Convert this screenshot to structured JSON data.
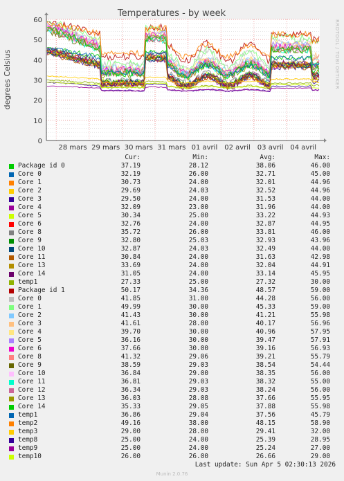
{
  "chart_data": {
    "type": "line",
    "title": "Temperatures - by week",
    "ylabel": "degrees Celsius",
    "ylim": [
      0,
      60
    ],
    "yticks": [
      0,
      10,
      20,
      30,
      40,
      50,
      60
    ],
    "x_categories": [
      "28 mars",
      "29 mars",
      "30 mars",
      "31 mars",
      "01 avril",
      "02 avril",
      "03 avril",
      "04 avril"
    ],
    "side_label": "RRDTOOL / TOBI OETIKER",
    "grid": true,
    "legend_headers": {
      "cur": "Cur:",
      "min": "Min:",
      "avg": "Avg:",
      "max": "Max:"
    },
    "series": [
      {
        "name": "Package id 0",
        "color": "#00cc00",
        "cur": "37.19",
        "min": "28.12",
        "avg": "38.06",
        "max": "46.00"
      },
      {
        "name": "Core 0",
        "color": "#0066b3",
        "cur": "32.19",
        "min": "26.00",
        "avg": "32.71",
        "max": "45.00"
      },
      {
        "name": "Core 1",
        "color": "#ff8000",
        "cur": "30.73",
        "min": "24.00",
        "avg": "32.01",
        "max": "44.96"
      },
      {
        "name": "Core 2",
        "color": "#ffcc00",
        "cur": "29.69",
        "min": "24.03",
        "avg": "32.52",
        "max": "44.96"
      },
      {
        "name": "Core 3",
        "color": "#330099",
        "cur": "29.50",
        "min": "24.00",
        "avg": "31.53",
        "max": "44.00"
      },
      {
        "name": "Core 4",
        "color": "#990099",
        "cur": "32.09",
        "min": "23.00",
        "avg": "31.96",
        "max": "44.00"
      },
      {
        "name": "Core 5",
        "color": "#ccff00",
        "cur": "30.34",
        "min": "25.00",
        "avg": "33.22",
        "max": "44.93"
      },
      {
        "name": "Core 6",
        "color": "#ff0000",
        "cur": "32.76",
        "min": "24.00",
        "avg": "32.87",
        "max": "44.95"
      },
      {
        "name": "Core 8",
        "color": "#808080",
        "cur": "35.72",
        "min": "26.00",
        "avg": "33.81",
        "max": "46.00"
      },
      {
        "name": "Core 9",
        "color": "#008f00",
        "cur": "32.80",
        "min": "25.03",
        "avg": "32.93",
        "max": "43.96"
      },
      {
        "name": "Core 10",
        "color": "#00487d",
        "cur": "32.87",
        "min": "24.03",
        "avg": "32.49",
        "max": "44.00"
      },
      {
        "name": "Core 11",
        "color": "#b35a00",
        "cur": "30.84",
        "min": "24.00",
        "avg": "31.63",
        "max": "42.98"
      },
      {
        "name": "Core 13",
        "color": "#b38f00",
        "cur": "33.69",
        "min": "24.00",
        "avg": "32.04",
        "max": "44.91"
      },
      {
        "name": "Core 14",
        "color": "#6b006b",
        "cur": "31.05",
        "min": "24.00",
        "avg": "33.14",
        "max": "45.95"
      },
      {
        "name": "temp1",
        "color": "#8fb300",
        "cur": "27.33",
        "min": "25.00",
        "avg": "27.32",
        "max": "30.00"
      },
      {
        "name": "Package id 1",
        "color": "#b30000",
        "cur": "50.17",
        "min": "34.36",
        "avg": "48.57",
        "max": "59.00"
      },
      {
        "name": "Core 0",
        "color": "#bebebe",
        "cur": "41.85",
        "min": "31.00",
        "avg": "44.28",
        "max": "56.00"
      },
      {
        "name": "Core 1",
        "color": "#80ff80",
        "cur": "49.99",
        "min": "30.00",
        "avg": "45.33",
        "max": "59.00"
      },
      {
        "name": "Core 2",
        "color": "#80c9ff",
        "cur": "41.43",
        "min": "30.00",
        "avg": "41.21",
        "max": "55.98"
      },
      {
        "name": "Core 3",
        "color": "#ffc080",
        "cur": "41.61",
        "min": "28.00",
        "avg": "40.17",
        "max": "56.96"
      },
      {
        "name": "Core 4",
        "color": "#ffe680",
        "cur": "39.70",
        "min": "30.00",
        "avg": "40.96",
        "max": "57.95"
      },
      {
        "name": "Core 5",
        "color": "#aa80ff",
        "cur": "36.16",
        "min": "30.00",
        "avg": "39.47",
        "max": "57.91"
      },
      {
        "name": "Core 6",
        "color": "#ee00cc",
        "cur": "37.66",
        "min": "30.00",
        "avg": "39.16",
        "max": "56.93"
      },
      {
        "name": "Core 8",
        "color": "#ff8080",
        "cur": "41.32",
        "min": "29.06",
        "avg": "39.21",
        "max": "55.79"
      },
      {
        "name": "Core 9",
        "color": "#666600",
        "cur": "38.59",
        "min": "29.03",
        "avg": "38.54",
        "max": "54.44"
      },
      {
        "name": "Core 10",
        "color": "#ffbfff",
        "cur": "36.84",
        "min": "29.00",
        "avg": "38.35",
        "max": "56.00"
      },
      {
        "name": "Core 11",
        "color": "#00ffcc",
        "cur": "36.81",
        "min": "29.03",
        "avg": "38.32",
        "max": "55.00"
      },
      {
        "name": "Core 12",
        "color": "#cc6699",
        "cur": "36.34",
        "min": "29.03",
        "avg": "38.24",
        "max": "56.00"
      },
      {
        "name": "Core 13",
        "color": "#999900",
        "cur": "36.03",
        "min": "28.08",
        "avg": "37.66",
        "max": "55.95"
      },
      {
        "name": "Core 14",
        "color": "#00cc00",
        "cur": "35.33",
        "min": "29.05",
        "avg": "37.88",
        "max": "55.98"
      },
      {
        "name": "temp1",
        "color": "#0066b3",
        "cur": "36.86",
        "min": "29.04",
        "avg": "37.56",
        "max": "45.79"
      },
      {
        "name": "temp2",
        "color": "#ff8000",
        "cur": "49.16",
        "min": "38.00",
        "avg": "48.15",
        "max": "58.90"
      },
      {
        "name": "temp3",
        "color": "#ffcc00",
        "cur": "29.00",
        "min": "28.00",
        "avg": "29.41",
        "max": "32.00"
      },
      {
        "name": "temp8",
        "color": "#330099",
        "cur": "25.00",
        "min": "24.00",
        "avg": "25.39",
        "max": "28.95"
      },
      {
        "name": "temp9",
        "color": "#990099",
        "cur": "25.00",
        "min": "24.00",
        "avg": "25.24",
        "max": "27.00"
      },
      {
        "name": "temp10",
        "color": "#ccff00",
        "cur": "26.00",
        "min": "26.00",
        "avg": "26.66",
        "max": "29.00"
      }
    ]
  },
  "footer": {
    "last_update": "Last update: Sun Apr  5 02:30:13 2026",
    "munin": "Munin 2.0.76"
  }
}
